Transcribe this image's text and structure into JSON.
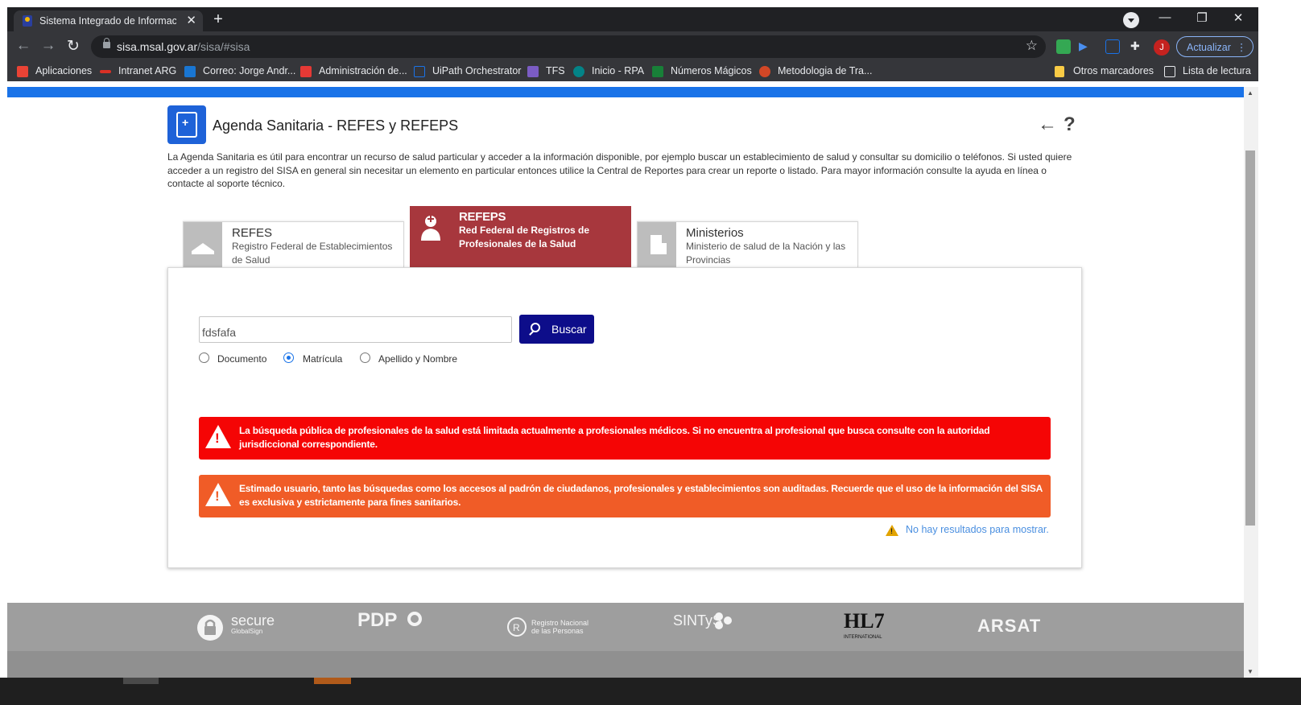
{
  "browser": {
    "tab_title": "Sistema Integrado de Información",
    "tab_close": "✕",
    "new_tab": "+",
    "window_controls": [
      "—",
      "❐",
      "✕"
    ],
    "url_host": "sisa.msal.gov.ar",
    "url_path": "/sisa/#sisa",
    "update_button": "Actualizar",
    "avatar_letter": "J",
    "bookmarks": [
      {
        "label": "Aplicaciones",
        "icon": "apps-grid-icon",
        "color": "#ea4335"
      },
      {
        "label": "Intranet ARG",
        "icon": "intranet-icon",
        "color": "#d93025"
      },
      {
        "label": "Correo: Jorge Andr...",
        "icon": "outlook-icon",
        "color": "#1976d2"
      },
      {
        "label": "Administración de...",
        "icon": "admin-icon",
        "color": "#e53935"
      },
      {
        "label": "UiPath Orchestrator",
        "icon": "uipath-icon",
        "color": "#1a73e8"
      },
      {
        "label": "TFS",
        "icon": "visual-studio-icon",
        "color": "#7b5cc4"
      },
      {
        "label": "Inicio - RPA",
        "icon": "sharepoint-icon",
        "color": "#038387"
      },
      {
        "label": "Números Mágicos",
        "icon": "sheet-icon",
        "color": "#188038"
      },
      {
        "label": "Metodologia de Tra...",
        "icon": "powerpoint-icon",
        "color": "#d24726"
      },
      {
        "label": "Otros marcadores",
        "icon": "folder-icon",
        "color": "#f9cb45"
      },
      {
        "label": "Lista de lectura",
        "icon": "reading-list-icon",
        "color": "#e8eaed"
      }
    ]
  },
  "page": {
    "title": "Agenda Sanitaria - REFES y REFEPS",
    "back_icon": "←",
    "help_icon": "?",
    "description": "La Agenda Sanitaria es útil para encontrar un recurso de salud particular y acceder a la información disponible, por ejemplo buscar un establecimiento de salud y consultar su domicilio o teléfonos. Si usted quiere acceder a un registro del SISA en general sin necesitar un elemento en particular entonces utilice la Central de Reportes para crear un reporte o listado. Para mayor información consulte la ayuda en línea o contacte al soporte técnico.",
    "tabs": [
      {
        "title": "REFES",
        "subtitle": "Registro Federal de Establecimientos de Salud"
      },
      {
        "title": "REFEPS",
        "subtitle": "Red Federal de Registros de Profesionales de la Salud"
      },
      {
        "title": "Ministerios",
        "subtitle": "Ministerio de salud de la Nación y las Provincias"
      }
    ],
    "search": {
      "value": "fdsfafa",
      "button": "Buscar",
      "options": [
        "Documento",
        "Matrícula",
        "Apellido y Nombre"
      ],
      "selected": "Matrícula"
    },
    "alerts": [
      {
        "type": "danger",
        "color": "#f50505",
        "text": "La búsqueda pública de profesionales de la salud está limitada actualmente a profesionales médicos. Si no encuentra al profesional que busca consulte con la autoridad jurisdiccional correspondiente."
      },
      {
        "type": "warning",
        "color": "#f05c27",
        "text": "Estimado usuario, tanto las búsquedas como los accesos al padrón de ciudadanos, profesionales y establecimientos son auditadas. Recuerde que el uso de la información del SISA es exclusiva y estrictamente para fines sanitarios."
      }
    ],
    "no_results": "No hay resultados para mostrar."
  },
  "footer": {
    "logos": [
      {
        "name": "secure",
        "sub": "GlobalSign"
      },
      {
        "name": "PDP",
        "sub": ""
      },
      {
        "name": "Registro Nacional de las Personas",
        "sub": ""
      },
      {
        "name": "SINTyS",
        "sub": ""
      },
      {
        "name": "HL7",
        "sub": "INTERNATIONAL"
      },
      {
        "name": "ARSAT",
        "sub": ""
      }
    ]
  },
  "colors": {
    "brand_blue": "#1a73e8",
    "active_tab": "#a7373d",
    "search_button": "#0d0d8a"
  }
}
